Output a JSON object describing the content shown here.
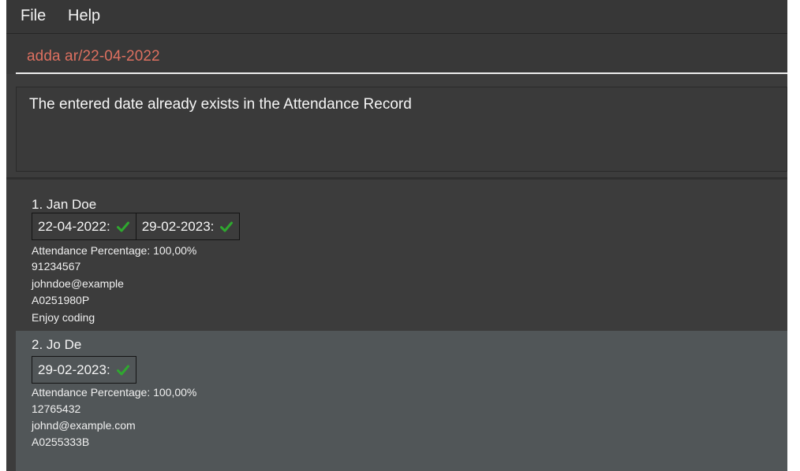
{
  "menu": {
    "file": "File",
    "help": "Help"
  },
  "command": {
    "value": "adda ar/22-04-2022"
  },
  "result": {
    "text": "The entered date already exists in the Attendance Record"
  },
  "persons": [
    {
      "index_name": "1.  Jan Doe",
      "attendance": [
        {
          "date": "22-04-2022:",
          "status": "check-icon"
        },
        {
          "date": "29-02-2023:",
          "status": "check-icon"
        }
      ],
      "percentage": "Attendance Percentage: 100,00%",
      "phone": "91234567",
      "email": "johndoe@example",
      "matric": "A0251980P",
      "remark": "Enjoy coding"
    },
    {
      "index_name": "2.  Jo De",
      "attendance": [
        {
          "date": "29-02-2023:",
          "status": "check-icon"
        }
      ],
      "percentage": "Attendance Percentage: 100,00%",
      "phone": "12765432",
      "email": "johnd@example.com",
      "matric": "A0255333B"
    }
  ],
  "colors": {
    "command_text": "#dd7060",
    "check": "#2fa82f",
    "card_selected_bg": "#515658"
  }
}
